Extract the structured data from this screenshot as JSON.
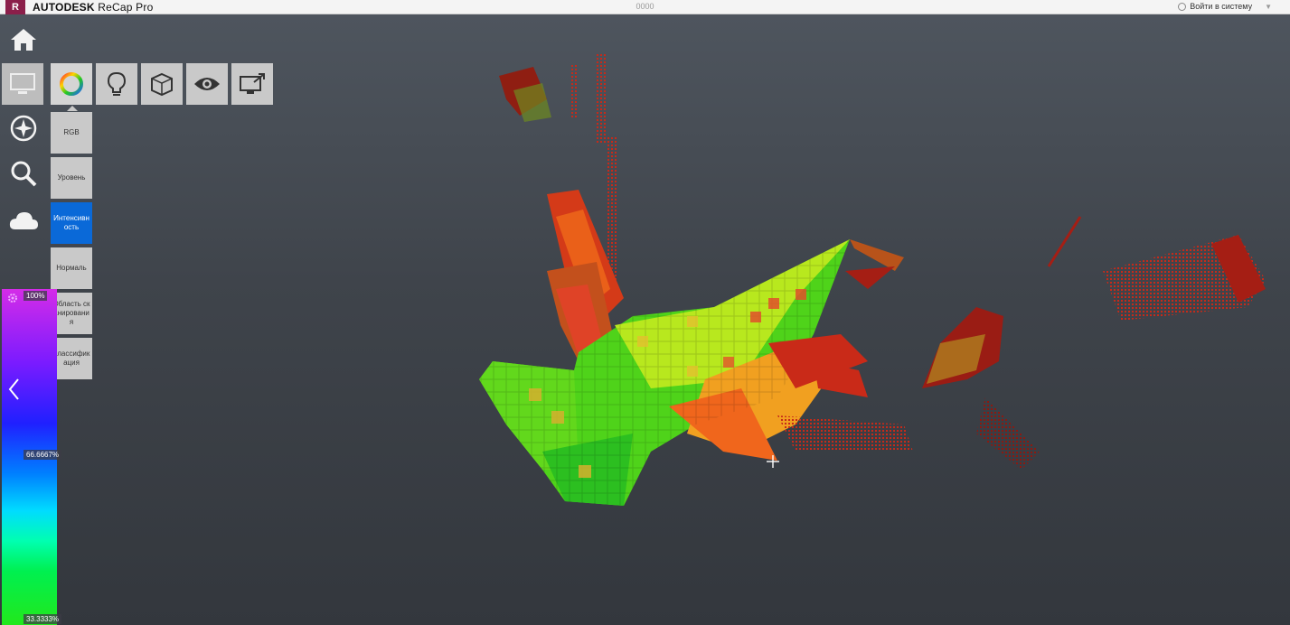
{
  "titlebar": {
    "logo_letter": "R",
    "brand_bold": "AUTODESK",
    "brand_product": "ReCap Pro",
    "document_title": "0000",
    "sign_in": "Войти в систему"
  },
  "toolbar": {
    "icons": [
      "home-icon",
      "display-icon",
      "navigate-icon",
      "search-icon",
      "cloud-icon"
    ],
    "tools": [
      "color-mode-icon",
      "lighting-icon",
      "box-icon",
      "visibility-icon",
      "export-icon"
    ]
  },
  "color_modes": {
    "items": [
      {
        "label": "RGB"
      },
      {
        "label": "Уровень"
      },
      {
        "label": "Интенсивность"
      },
      {
        "label": "Нормаль"
      },
      {
        "label": "Область сканирования"
      },
      {
        "label": "Классификация"
      }
    ],
    "selected": "Интенсивность"
  },
  "legend": {
    "top_label": "100%",
    "mid_label": "66.6667%",
    "bottom_label": "33.3333%"
  },
  "colors": {
    "selected": "#0a69d8",
    "button": "#c9c9c9",
    "brand": "#8b1f4a"
  }
}
